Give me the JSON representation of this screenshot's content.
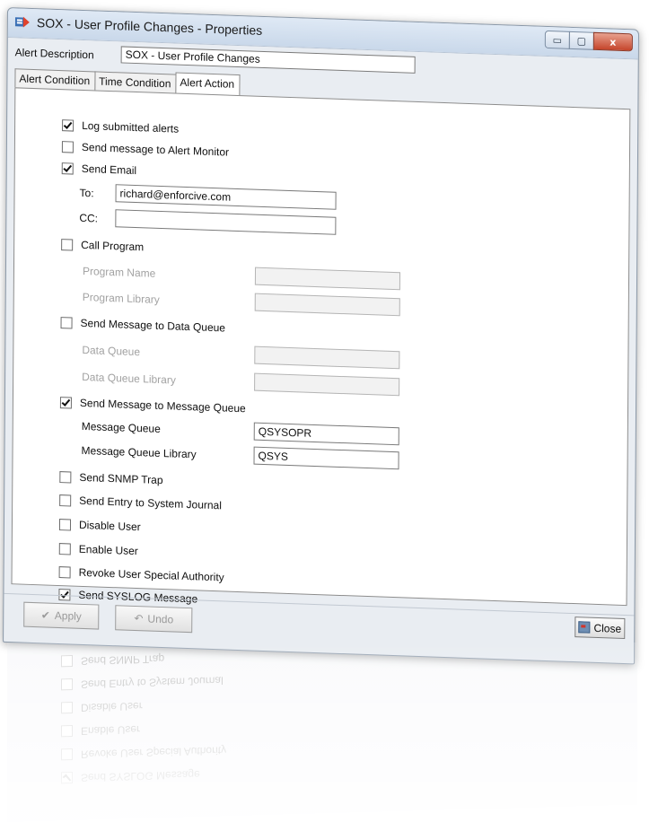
{
  "window": {
    "title": "SOX - User Profile Changes - Properties",
    "min_glyph": "▭",
    "max_glyph": "▢",
    "close_glyph": "x"
  },
  "alert_description": {
    "label": "Alert Description",
    "value": "SOX - User Profile Changes"
  },
  "tabs": [
    {
      "label": "Alert Condition"
    },
    {
      "label": "Time Condition"
    },
    {
      "label": "Alert Action"
    }
  ],
  "active_tab": "Alert Action",
  "options": {
    "log_submitted_alerts": {
      "label": "Log submitted alerts",
      "checked": true
    },
    "send_message_alert_monitor": {
      "label": "Send message to Alert Monitor",
      "checked": false
    },
    "send_email": {
      "label": "Send Email",
      "checked": true
    },
    "call_program": {
      "label": "Call Program",
      "checked": false
    },
    "send_message_data_queue": {
      "label": "Send Message to Data Queue",
      "checked": false
    },
    "send_message_message_queue": {
      "label": "Send Message to Message Queue",
      "checked": true
    },
    "send_snmp_trap": {
      "label": "Send SNMP Trap",
      "checked": false
    },
    "send_entry_system_journal": {
      "label": "Send Entry to System Journal",
      "checked": false
    },
    "disable_user": {
      "label": "Disable User",
      "checked": false
    },
    "enable_user": {
      "label": "Enable User",
      "checked": false
    },
    "revoke_user_special_authority": {
      "label": "Revoke User Special Authority",
      "checked": false
    },
    "send_syslog_message": {
      "label": "Send SYSLOG Message",
      "checked": true
    }
  },
  "email": {
    "to_label": "To:",
    "to_value": "richard@enforcive.com",
    "cc_label": "CC:",
    "cc_value": ""
  },
  "program": {
    "name_label": "Program Name",
    "library_label": "Program Library"
  },
  "data_queue": {
    "queue_label": "Data Queue",
    "library_label": "Data Queue Library"
  },
  "message_queue": {
    "queue_label": "Message Queue",
    "queue_value": "QSYSOPR",
    "library_label": "Message Queue Library",
    "library_value": "QSYS"
  },
  "buttons": {
    "close": "Close",
    "apply": "Apply",
    "undo": "Undo"
  },
  "colors": {
    "title_bar": "#c9d8ea",
    "close_button": "#c5452b",
    "panel": "#ffffff"
  }
}
